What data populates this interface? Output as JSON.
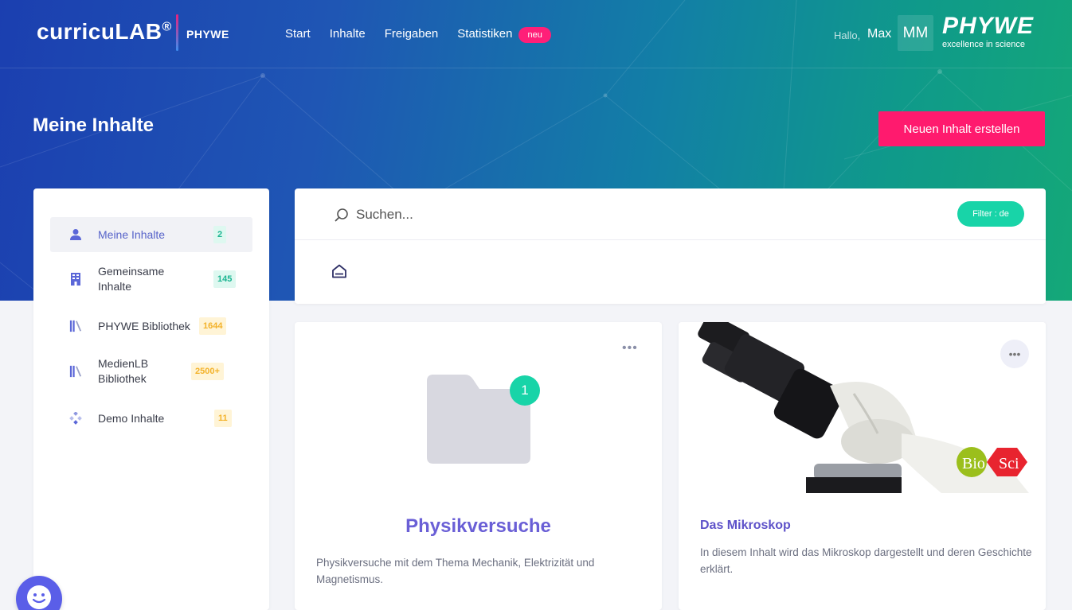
{
  "header": {
    "logo_text": "curricuLAB",
    "logo_reg": "®",
    "logo_partner": "PHYWE",
    "nav": [
      {
        "label": "Start"
      },
      {
        "label": "Inhalte"
      },
      {
        "label": "Freigaben"
      },
      {
        "label": "Statistiken"
      }
    ],
    "nav_badge": "neu",
    "greeting": "Hallo,",
    "user_name": "Max",
    "avatar_initials": "MM",
    "brand_name": "PHYWE",
    "brand_tagline": "excellence in science"
  },
  "page": {
    "title": "Meine Inhalte",
    "create_button": "Neuen Inhalt erstellen"
  },
  "sidebar": {
    "items": [
      {
        "label": "Meine Inhalte",
        "count": "2",
        "icon": "user-icon",
        "active": true
      },
      {
        "label": "Gemeinsame Inhalte",
        "count": "145",
        "icon": "building-icon"
      },
      {
        "label": "PHYWE Bibliothek",
        "count": "1644",
        "icon": "library-icon"
      },
      {
        "label": "MedienLB Bibliothek",
        "count": "2500+",
        "icon": "library-icon"
      },
      {
        "label": "Demo Inhalte",
        "count": "11",
        "icon": "diamond-icon"
      }
    ]
  },
  "search": {
    "placeholder": "Suchen...",
    "filter_label": "Filter : de"
  },
  "cards": [
    {
      "title": "Physikversuche",
      "description": "Physikversuche mit dem Thema Mechanik, Elektrizität und Magnetismus.",
      "folder_count": "1",
      "type": "folder"
    },
    {
      "title": "Das Mikroskop",
      "description": "In diesem Inhalt wird das Mikroskop dargestellt und deren Geschichte erklärt.",
      "tags": [
        "Bio",
        "Sci"
      ],
      "type": "content"
    }
  ],
  "colors": {
    "accent_pink": "#ff1a6e",
    "accent_teal": "#18d4a8",
    "title_purple": "#6a5fd6"
  }
}
